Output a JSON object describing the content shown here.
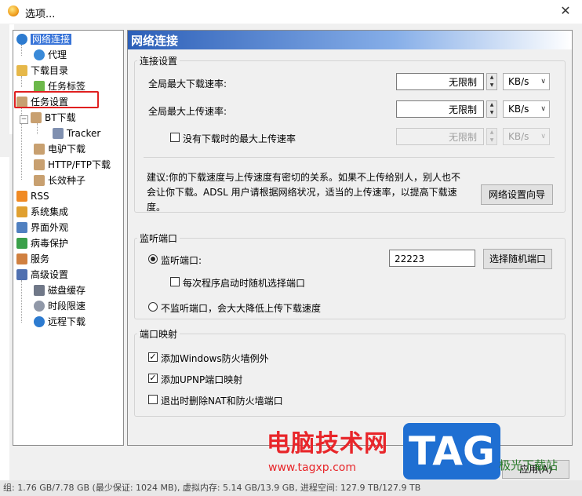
{
  "window": {
    "title": "选项..."
  },
  "tree": {
    "items": [
      {
        "label": "网络连接",
        "icon": "globe-icon",
        "color": "#2d7bd0"
      },
      {
        "label": "代理",
        "icon": "globe-icon",
        "color": "#3a8ad8"
      },
      {
        "label": "下载目录",
        "icon": "folder-icon",
        "color": "#e6b84a"
      },
      {
        "label": "任务标签",
        "icon": "tag-icon",
        "color": "#6cb84a"
      },
      {
        "label": "任务设置",
        "icon": "clipboard-icon",
        "color": "#c8a070"
      },
      {
        "label": "BT下载",
        "icon": "clipboard-icon",
        "color": "#c8a070"
      },
      {
        "label": "Tracker",
        "icon": "server-icon",
        "color": "#8090b0"
      },
      {
        "label": "电驴下载",
        "icon": "clipboard-icon",
        "color": "#c8a070"
      },
      {
        "label": "HTTP/FTP下载",
        "icon": "clipboard-icon",
        "color": "#c8a070"
      },
      {
        "label": "长效种子",
        "icon": "clipboard-icon",
        "color": "#c8a070"
      },
      {
        "label": "RSS",
        "icon": "rss-icon",
        "color": "#f08a24"
      },
      {
        "label": "系统集成",
        "icon": "puzzle-icon",
        "color": "#e0a030"
      },
      {
        "label": "界面外观",
        "icon": "window-icon",
        "color": "#5080c0"
      },
      {
        "label": "病毒保护",
        "icon": "shield-icon",
        "color": "#3aa04a"
      },
      {
        "label": "服务",
        "icon": "people-icon",
        "color": "#d08040"
      },
      {
        "label": "高级设置",
        "icon": "settings-window-icon",
        "color": "#5070b0"
      },
      {
        "label": "磁盘缓存",
        "icon": "disk-icon",
        "color": "#707888"
      },
      {
        "label": "时段限速",
        "icon": "clock-icon",
        "color": "#9098a8"
      },
      {
        "label": "远程下载",
        "icon": "globe-icon",
        "color": "#2d7bd0"
      }
    ]
  },
  "panel": {
    "title": "网络连接",
    "connection": {
      "group_title": "连接设置",
      "max_download_label": "全局最大下载速率:",
      "max_download_value": "无限制",
      "max_download_unit": "KB/s",
      "max_upload_label": "全局最大上传速率:",
      "max_upload_value": "无限制",
      "max_upload_unit": "KB/s",
      "idle_upload_label": "没有下载时的最大上传速率",
      "idle_upload_value": "无限制",
      "idle_upload_unit": "KB/s",
      "advice_line1": "建议:你的下载速度与上传速度有密切的关系。如果不上传给别人，别人也不",
      "advice_line2": "会让你下载。ADSL 用户请根据网络状况，适当的上传速率，以提高下载速",
      "advice_line3": "度。",
      "wizard_button": "网络设置向导"
    },
    "listen": {
      "group_title": "监听端口",
      "listen_label": "监听端口:",
      "port_value": "22223",
      "random_port_button": "选择随机端口",
      "random_on_start_label": "每次程序启动时随机选择端口",
      "no_listen_label": "不监听端口，会大大降低上传下载速度"
    },
    "mapping": {
      "group_title": "端口映射",
      "firewall_label": "添加Windows防火墙例外",
      "upnp_label": "添加UPNP端口映射",
      "remove_nat_label": "退出时删除NAT和防火墙端口"
    }
  },
  "footer": {
    "apply_button": "应用(A)",
    "status_text": "组: 1.76 GB/7.78 GB (最少保证: 1024 MB), 虚拟内存: 5.14 GB/13.9 GB, 进程空间: 127.9 TB/127.9 TB"
  },
  "watermark": {
    "brand": "电脑技术网",
    "url": "www.tagxp.com",
    "tag": "TAG",
    "site": "极光下载站"
  }
}
